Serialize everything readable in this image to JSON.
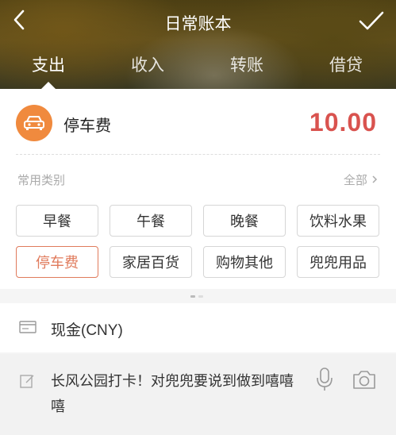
{
  "header": {
    "title": "日常账本",
    "tabs": [
      {
        "label": "支出",
        "active": true
      },
      {
        "label": "收入",
        "active": false
      },
      {
        "label": "转账",
        "active": false
      },
      {
        "label": "借贷",
        "active": false
      }
    ]
  },
  "entry": {
    "category_icon": "car-icon",
    "category_name": "停车费",
    "amount": "10.00"
  },
  "categories": {
    "label": "常用类别",
    "all_label": "全部",
    "items": [
      {
        "label": "早餐"
      },
      {
        "label": "午餐"
      },
      {
        "label": "晚餐"
      },
      {
        "label": "饮料水果"
      },
      {
        "label": "停车费",
        "selected": true
      },
      {
        "label": "家居百货"
      },
      {
        "label": "购物其他"
      },
      {
        "label": "兜兜用品"
      }
    ]
  },
  "account": {
    "label": "现金(CNY)"
  },
  "note": {
    "text": "长风公园打卡！对兜兜要说到做到嘻嘻嘻"
  },
  "colors": {
    "accent": "#e07b5c",
    "amount": "#d9534f",
    "category_icon_bg": "#f08a3e"
  }
}
